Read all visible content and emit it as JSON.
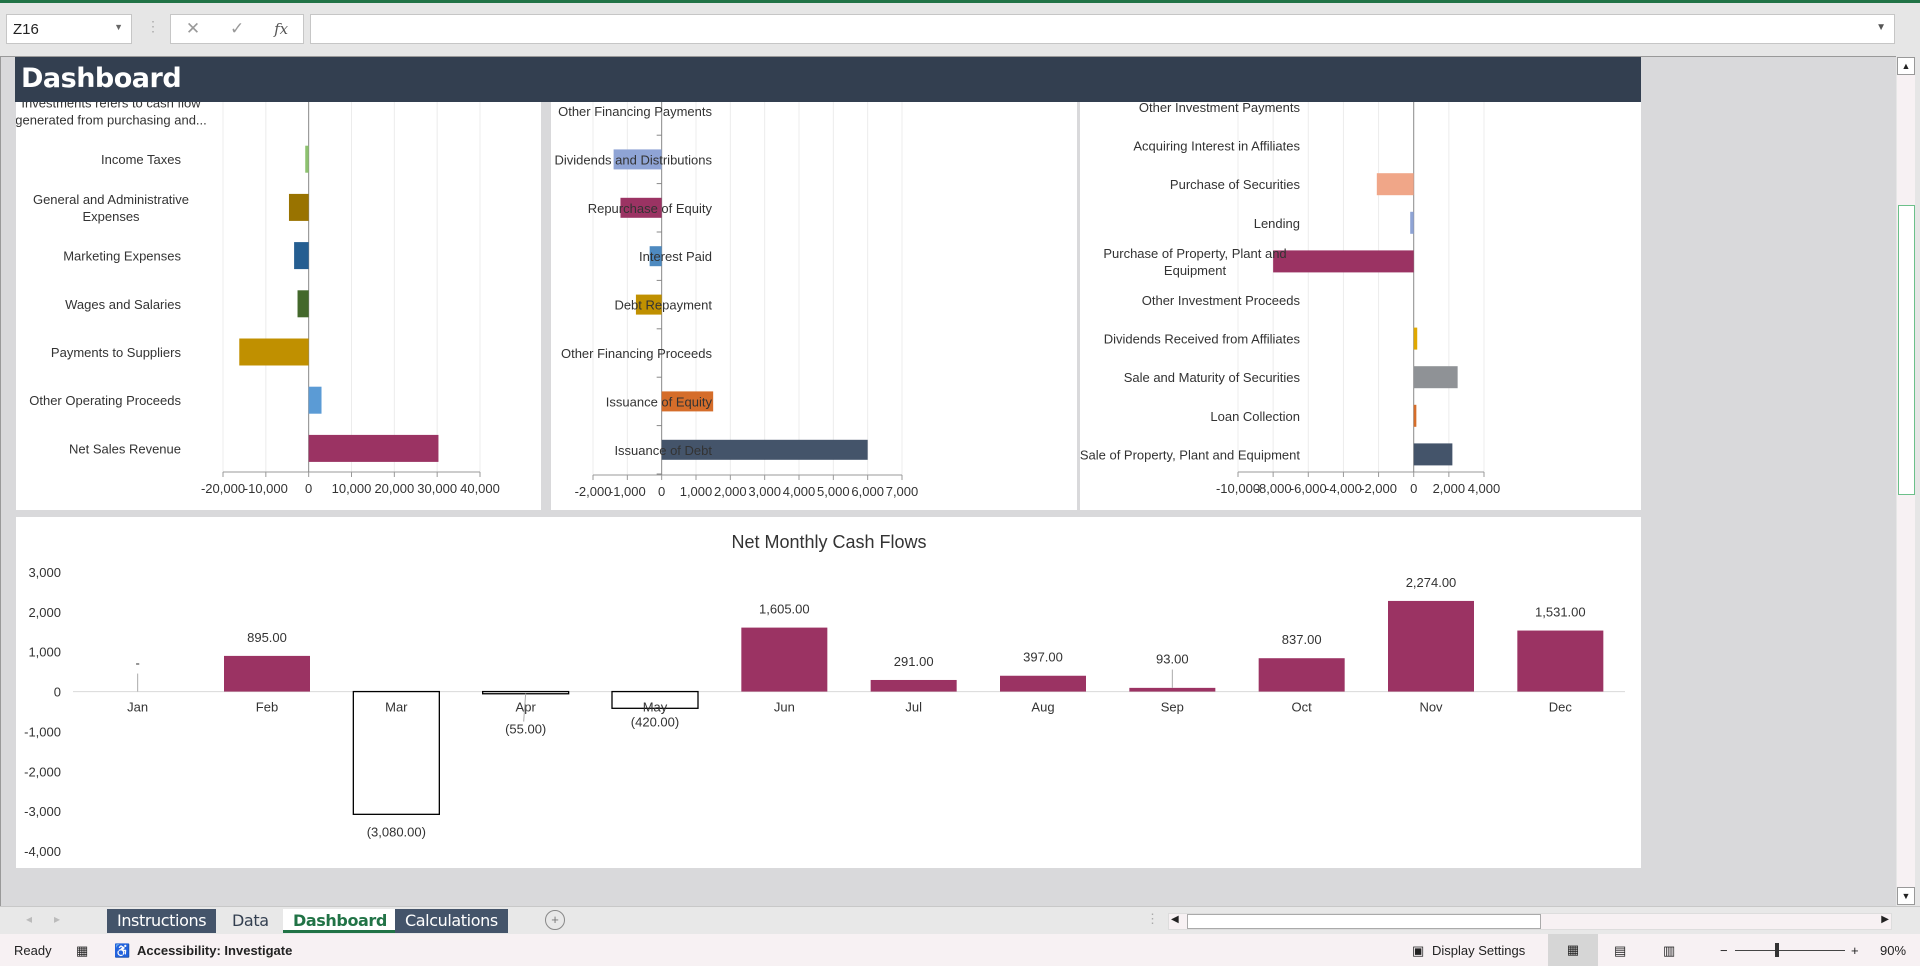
{
  "formula_bar": {
    "name_box": "Z16",
    "cancel_icon": "✕",
    "enter_icon": "✓",
    "fx_label": "fx",
    "formula": ""
  },
  "header": {
    "title": "Dashboard"
  },
  "charts": {
    "operating": {
      "type": "bar",
      "orientation": "horizontal",
      "xlim": [
        -20000,
        40000
      ],
      "tick_step": 10000,
      "tick_labels": [
        "-20,000",
        "-10,000",
        "0",
        "10,000",
        "20,000",
        "30,000",
        "40,000"
      ],
      "categories": [
        "Investments refers to cash flow generated from purchasing and...",
        "Income Taxes",
        "General and Administrative Expenses",
        "Marketing Expenses",
        "Wages and Salaries",
        "Payments to Suppliers",
        "Other Operating Proceeds",
        "Net Sales Revenue"
      ],
      "values": [
        0,
        -800,
        -4600,
        -3400,
        -2600,
        -16200,
        3000,
        30300
      ],
      "colors": [
        "#ffffff",
        "#8dc26f",
        "#997300",
        "#255e91",
        "#43682b",
        "#c09000",
        "#5b9bd5",
        "#9b3363"
      ]
    },
    "financing": {
      "type": "bar",
      "orientation": "horizontal",
      "xlim": [
        -2000,
        7000
      ],
      "tick_step": 1000,
      "tick_labels": [
        "-2,000",
        "-1,000",
        "0",
        "1,000",
        "2,000",
        "3,000",
        "4,000",
        "5,000",
        "6,000",
        "7,000"
      ],
      "categories": [
        "Other Financing Payments",
        "Dividends and Distributions",
        "Repurchase of Equity",
        "Interest Paid",
        "Debt Repayment",
        "Other Financing Proceeds",
        "Issuance of Equity",
        "Issuance of Debt"
      ],
      "values": [
        0,
        -1400,
        -1200,
        -350,
        -750,
        0,
        1500,
        6000
      ],
      "colors": [
        "#ffffff",
        "#8fa4d5",
        "#9b3363",
        "#4e8ac0",
        "#c09000",
        "#ffffff",
        "#d56d2a",
        "#44546a"
      ]
    },
    "investing": {
      "type": "bar",
      "orientation": "horizontal",
      "xlim": [
        -10000,
        4000
      ],
      "tick_step": 2000,
      "tick_labels": [
        "-10,000",
        "-8,000",
        "-6,000",
        "-4,000",
        "-2,000",
        "0",
        "2,000",
        "4,000"
      ],
      "categories": [
        "Other Investment Payments",
        "Acquiring Interest in Affiliates",
        "Purchase of Securities",
        "Lending",
        "Purchase of Property, Plant and Equipment",
        "Other Investment Proceeds",
        "Dividends Received from Affiliates",
        "Sale and Maturity of Securities",
        "Loan Collection",
        "Sale of Property, Plant and Equipment"
      ],
      "values": [
        0,
        0,
        -2100,
        -200,
        -8000,
        0,
        200,
        2500,
        150,
        2200
      ],
      "colors": [
        "#ffffff",
        "#ffffff",
        "#f0a688",
        "#8fa4d5",
        "#9b3363",
        "#ffffff",
        "#e0a800",
        "#8f9296",
        "#d56d2a",
        "#44546a"
      ]
    }
  },
  "chart_data": {
    "type": "bar",
    "title": "Net Monthly Cash Flows",
    "categories": [
      "Jan",
      "Feb",
      "Mar",
      "Apr",
      "May",
      "Jun",
      "Jul",
      "Aug",
      "Sep",
      "Oct",
      "Nov",
      "Dec"
    ],
    "values": [
      0,
      895,
      -3080,
      -55,
      -420,
      1605,
      291,
      397,
      93,
      837,
      2274,
      1531
    ],
    "data_labels": [
      "-",
      "895.00",
      "(3,080.00)",
      "(55.00)",
      "(420.00)",
      "1,605.00",
      "291.00",
      "397.00",
      "93.00",
      "837.00",
      "2,274.00",
      "1,531.00"
    ],
    "ylim": [
      -4000,
      3000
    ],
    "tick_labels": [
      "3,000",
      "2,000",
      "1,000",
      "0",
      "-1,000",
      "-2,000",
      "-3,000",
      "-4,000"
    ],
    "positive_color": "#9b3363",
    "negative_fill": "#ffffff",
    "negative_outline": "#000000",
    "grid": false,
    "legend": "none"
  },
  "sheet_tabs": [
    {
      "label": "Instructions"
    },
    {
      "label": "Data"
    },
    {
      "label": "Dashboard",
      "active": true
    },
    {
      "label": "Calculations"
    }
  ],
  "status_bar": {
    "ready": "Ready",
    "accessibility": "Accessibility: Investigate",
    "display_settings": "Display Settings",
    "zoom": "90%",
    "zoom_minus": "−",
    "zoom_plus": "+"
  }
}
